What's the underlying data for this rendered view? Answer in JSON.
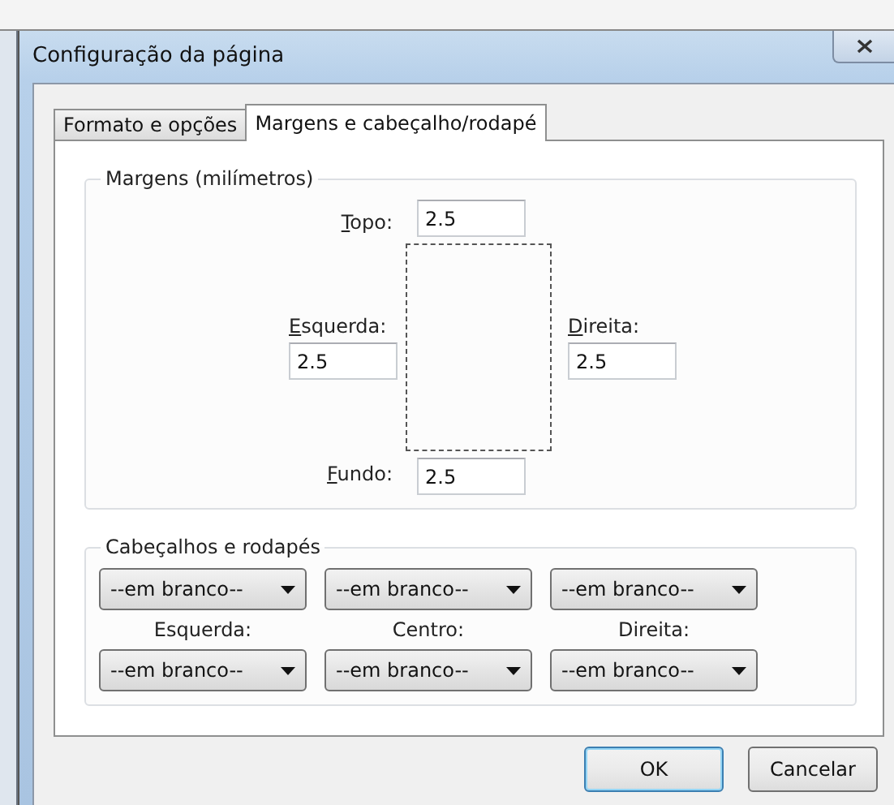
{
  "window": {
    "title": "Configuração da página"
  },
  "tabs": [
    {
      "label": "Formato e opções",
      "selected": false
    },
    {
      "label": "Margens e cabeçalho/rodapé",
      "selected": true
    }
  ],
  "margins": {
    "title": "Margens (milímetros)",
    "top": {
      "label": "Topo:",
      "mnemonic": true,
      "value": "2.5"
    },
    "left": {
      "label": "Esquerda:",
      "mnemonic": true,
      "value": "2.5"
    },
    "right": {
      "label": "Direita:",
      "mnemonic": true,
      "value": "2.5"
    },
    "bottom": {
      "label": "Fundo:",
      "mnemonic": true,
      "value": "2.5"
    }
  },
  "headers_footers": {
    "title": "Cabeçalhos e rodapés",
    "headers": [
      "--em branco--",
      "--em branco--",
      "--em branco--"
    ],
    "labels": [
      "Esquerda:",
      "Centro:",
      "Direita:"
    ],
    "footers": [
      "--em branco--",
      "--em branco--",
      "--em branco--"
    ]
  },
  "buttons": [
    {
      "label": "OK",
      "default": true
    },
    {
      "label": "Cancelar",
      "default": false
    }
  ]
}
